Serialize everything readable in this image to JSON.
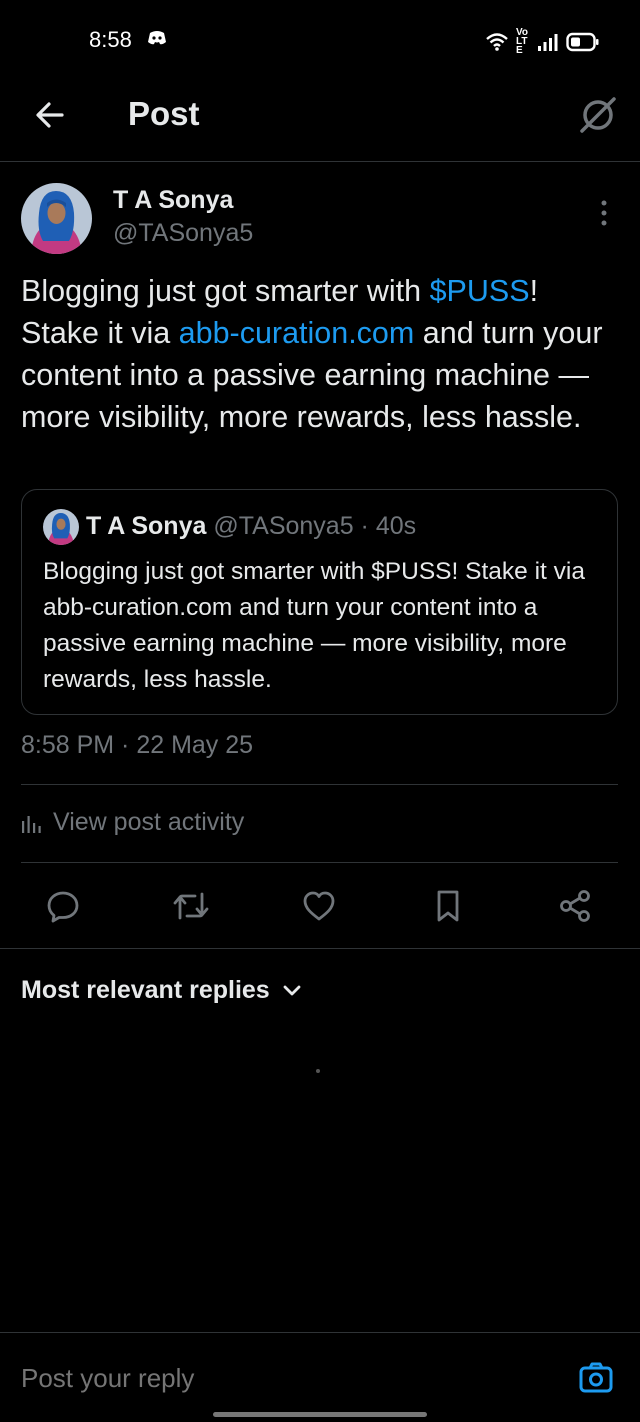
{
  "status_bar": {
    "time": "8:58",
    "icons": [
      "discord-icon",
      "wifi-icon",
      "volte-icon",
      "signal-icon",
      "battery-icon"
    ],
    "volte_text": "Vo LTE"
  },
  "header": {
    "title": "Post",
    "back_icon": "back-arrow-icon",
    "grok_icon": "grok-icon"
  },
  "post": {
    "author_name": "T A Sonya",
    "author_handle": "@TASonya5",
    "text_part1": "Blogging just got smarter with ",
    "cashtag": "$PUSS",
    "text_part2": "! Stake it via ",
    "link": "abb-curation.com",
    "text_part3": " and turn your content into a passive earning machine — more visibility, more rewards, less hassle.",
    "timestamp": "8:58 PM · 22 May 25"
  },
  "quoted_post": {
    "author_name": "T A Sonya",
    "meta": "@TASonya5 · 40s",
    "text": "Blogging just got smarter with $PUSS! Stake it via abb-curation.com and turn your content into a passive earning machine — more visibility, more rewards, less hassle."
  },
  "activity": {
    "label": "View post activity"
  },
  "actions": [
    "reply-icon",
    "repost-icon",
    "like-icon",
    "bookmark-icon",
    "share-icon"
  ],
  "replies": {
    "sort_label": "Most relevant replies"
  },
  "reply_bar": {
    "placeholder": "Post your reply"
  },
  "colors": {
    "background": "#000000",
    "text": "#e7e9ea",
    "muted": "#71767b",
    "link": "#1d9bf0",
    "divider": "#2f3336"
  }
}
